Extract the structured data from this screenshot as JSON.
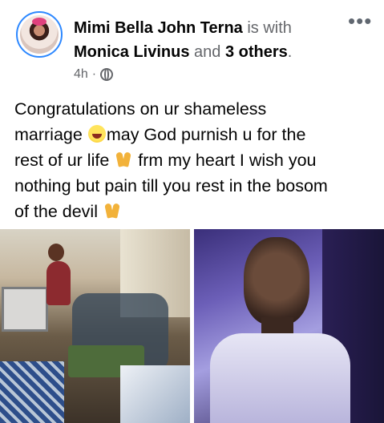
{
  "post": {
    "author": "Mimi Bella John Terna",
    "with_text": "is with",
    "tagged": "Monica Livinus",
    "and_text": "and",
    "others": "3 others",
    "period": ".",
    "time": "4h",
    "separator": "·",
    "privacy_icon": "globe-icon",
    "more_icon": "more-options-icon",
    "text_line1": "Congratulations on ur shameless",
    "text_line2": "marriage",
    "text_line2b": "may God purnish u for the",
    "text_line3": "rest of ur life",
    "text_line3b": "frm my heart I wish you",
    "text_line4": "nothing but pain till you rest in the bosom",
    "text_line5": "of the devil"
  },
  "colors": {
    "avatar_ring": "#2d88ff",
    "secondary_text": "#65676b",
    "primary_text": "#050505"
  }
}
